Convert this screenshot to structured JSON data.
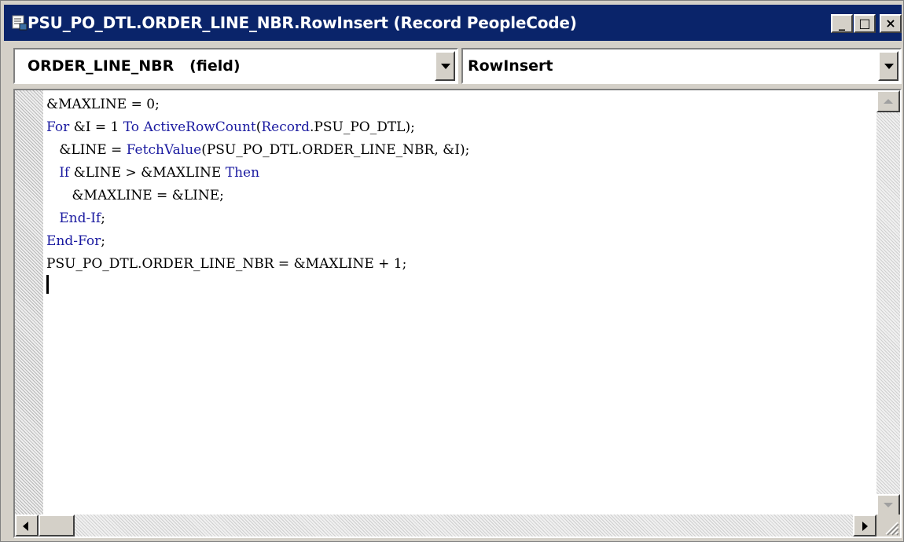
{
  "window": {
    "title": "PSU_PO_DTL.ORDER_LINE_NBR.RowInsert (Record PeopleCode)",
    "titlebar_color": "#0a246a",
    "controls": {
      "minimize": "_",
      "maximize": "□",
      "close": "×"
    }
  },
  "toolbar": {
    "field_selector": {
      "value": "ORDER_LINE_NBR   (field)"
    },
    "event_selector": {
      "value": "RowInsert"
    }
  },
  "editor": {
    "lines": [
      "&MAXLINE = 0;",
      "For &I = 1 To ActiveRowCount(Record.PSU_PO_DTL);",
      "   &LINE = FetchValue(PSU_PO_DTL.ORDER_LINE_NBR, &I);",
      "   If &LINE > &MAXLINE Then",
      "      &MAXLINE = &LINE;",
      "   End-If;",
      "End-For;",
      "PSU_PO_DTL.ORDER_LINE_NBR = &MAXLINE + 1;"
    ],
    "keyword_color": "#1a1aa0"
  },
  "icons": {
    "app": "peoplecode-document-icon",
    "minimize": "minimize-icon",
    "maximize": "maximize-icon",
    "close": "close-icon"
  }
}
